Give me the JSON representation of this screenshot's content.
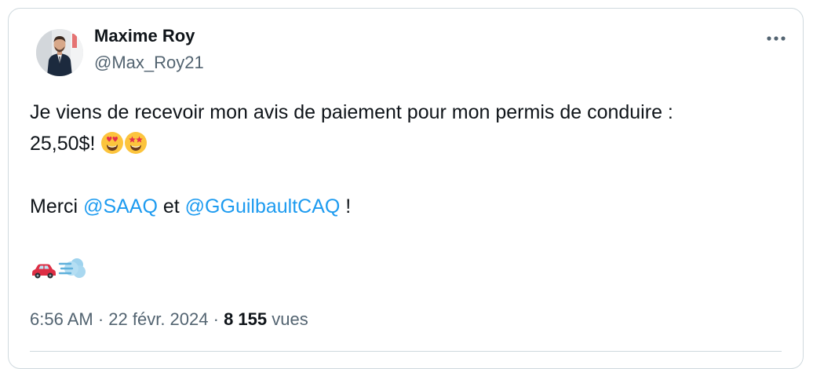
{
  "author": {
    "name": "Maxime Roy",
    "handle": "@Max_Roy21"
  },
  "tweet": {
    "line1": "Je viens de recevoir mon avis de paiement pour mon permis de conduire :",
    "line2_text": "25,50$!",
    "line2_emojis": [
      "heart-eyes-emoji",
      "star-struck-emoji"
    ],
    "line3_prefix": "Merci ",
    "mention_1": "@SAAQ",
    "line3_middle": " et ",
    "mention_2": "@GGuilbaultCAQ",
    "line3_suffix": " !",
    "line4_emojis": [
      "red-car-emoji",
      "dash-emoji"
    ]
  },
  "meta": {
    "time": "6:56 AM",
    "sep1": " · ",
    "date": "22 févr. 2024",
    "sep2": " · ",
    "views_count": "8 155",
    "views_label": " vues"
  },
  "icons": {
    "more": "more-horizontal-icon"
  },
  "colors": {
    "text": "#0f1419",
    "secondary": "#536471",
    "link": "#1d9bf0",
    "border": "#cfd9de"
  }
}
